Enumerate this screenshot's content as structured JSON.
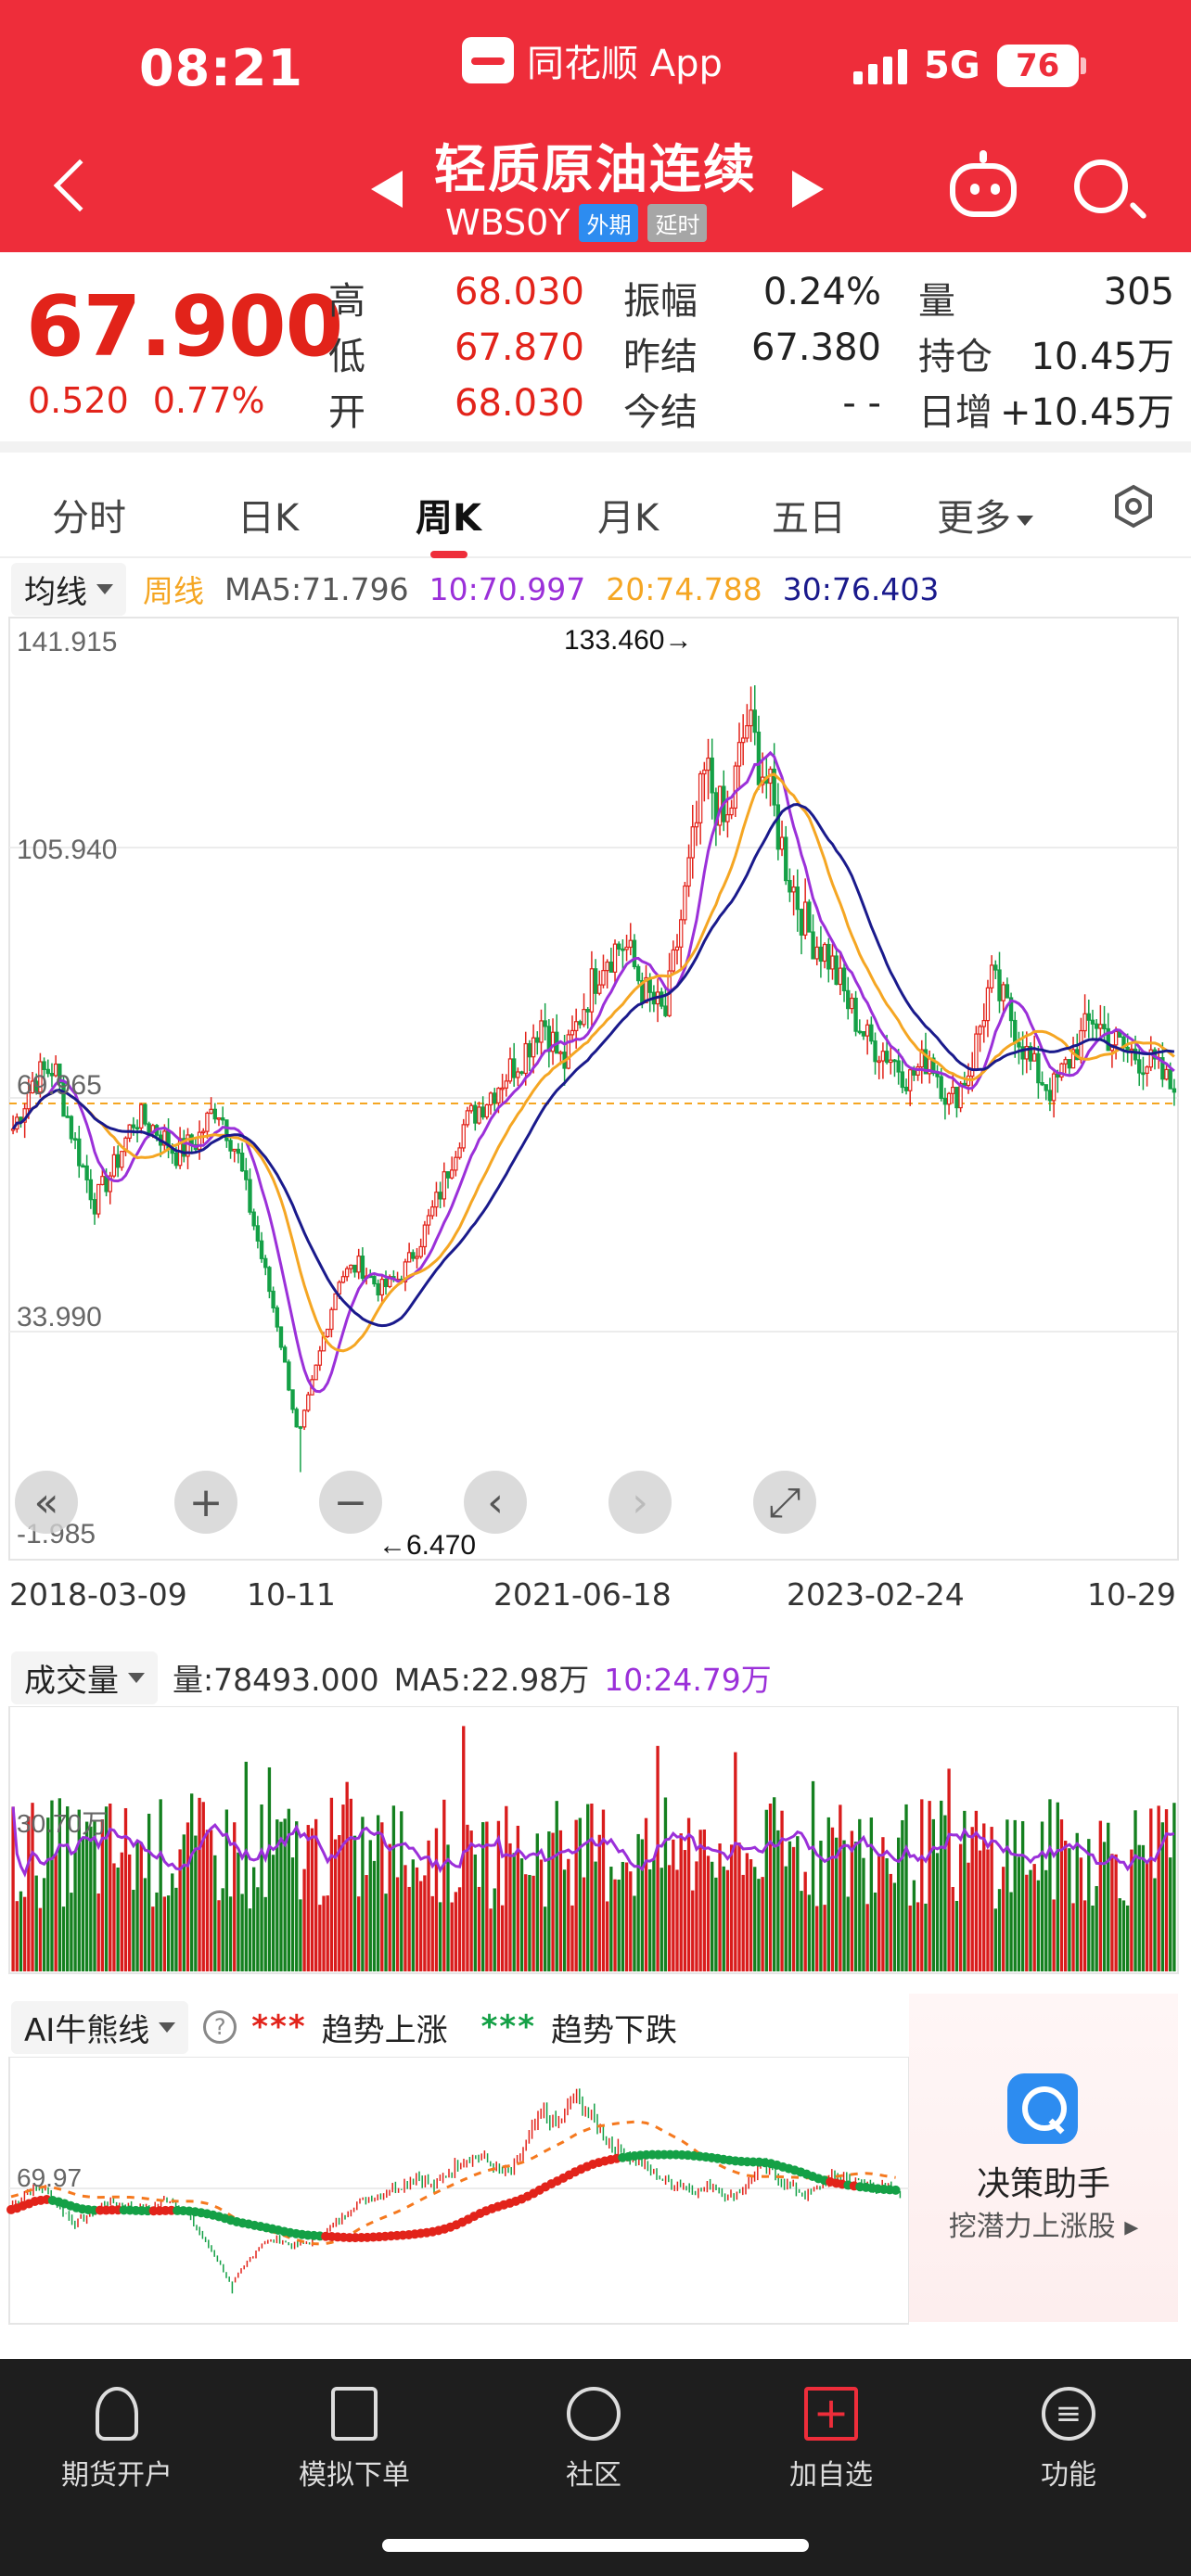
{
  "status_bar": {
    "time": "08:21",
    "app_name": "同花顺 App",
    "network": "5G",
    "battery": "76"
  },
  "header": {
    "title": "轻质原油连续",
    "symbol": "WBS0Y",
    "tag_market": "外期",
    "tag_delay": "延时"
  },
  "quote": {
    "price": "67.900",
    "change": "0.520",
    "change_pct": "0.77%",
    "high_label": "高",
    "high": "68.030",
    "low_label": "低",
    "low": "67.870",
    "open_label": "开",
    "open": "68.030",
    "amplitude_label": "振幅",
    "amplitude": "0.24%",
    "prev_settle_label": "昨结",
    "prev_settle": "67.380",
    "today_settle_label": "今结",
    "today_settle": "- -",
    "volume_label": "量",
    "volume": "305",
    "position_label": "持仓",
    "position": "10.45万",
    "daily_inc_label": "日增",
    "daily_inc": "+10.45万"
  },
  "tabs": [
    {
      "label": "分时"
    },
    {
      "label": "日K"
    },
    {
      "label": "周K",
      "active": true
    },
    {
      "label": "月K"
    },
    {
      "label": "五日"
    },
    {
      "label": "更多"
    }
  ],
  "ma_legend": {
    "dropdown": "均线",
    "period": "周线",
    "ma5": "MA5:71.796",
    "ma10": "10:70.997",
    "ma20": "20:74.788",
    "ma30": "30:76.403",
    "colors": {
      "period": "#f5a623",
      "ma5": "#555555",
      "ma10": "#9b30d9",
      "ma20": "#f5a623",
      "ma30": "#1a1a8c"
    }
  },
  "price_chart": {
    "y_labels": [
      "141.915",
      "105.940",
      "69.965",
      "33.990",
      "-1.985"
    ],
    "max_label": "133.460→",
    "min_label": "←6.470",
    "x_labels": [
      "2018-03-09",
      "10-11",
      "2021-06-18",
      "2023-02-24",
      "10-29"
    ]
  },
  "chart_data": {
    "type": "candlestick",
    "title": "",
    "xlabel": "",
    "ylabel": "",
    "ylim": [
      -1.985,
      141.915
    ],
    "x_ticks": [
      "2018-03-09",
      "10-11",
      "2021-06-18",
      "2023-02-24",
      "10-29"
    ],
    "period": "weekly",
    "max": 133.46,
    "min": 6.47,
    "last": 67.9,
    "trend_samples": [
      62,
      70,
      72,
      60,
      50,
      56,
      64,
      62,
      58,
      60,
      66,
      58,
      44,
      30,
      12,
      25,
      38,
      40,
      36,
      38,
      44,
      52,
      62,
      66,
      70,
      74,
      80,
      72,
      82,
      90,
      92,
      84,
      80,
      100,
      120,
      110,
      128,
      118,
      104,
      94,
      90,
      82,
      76,
      74,
      70,
      74,
      66,
      72,
      86,
      80,
      72,
      68,
      74,
      80,
      76,
      74,
      72,
      68
    ]
  },
  "volume": {
    "dropdown": "成交量",
    "vol": "量:78493.000",
    "ma5": "MA5:22.98万",
    "ma10": "10:24.79万",
    "y_label": "30.70万"
  },
  "ai_indicator": {
    "dropdown": "AI牛熊线",
    "help": "?",
    "up_dots": "***",
    "up_label": "趋势上涨",
    "down_dots": "***",
    "down_label": "趋势下跌",
    "y_label": "69.97"
  },
  "decision_panel": {
    "title": "决策助手",
    "subtitle": "挖潜力上涨股 ▸"
  },
  "bottom_nav": [
    {
      "label": "期货开户",
      "icon": "person-icon"
    },
    {
      "label": "模拟下单",
      "icon": "document-icon"
    },
    {
      "label": "社区",
      "icon": "community-icon"
    },
    {
      "label": "加自选",
      "icon": "add-icon"
    },
    {
      "label": "功能",
      "icon": "menu-icon"
    }
  ]
}
